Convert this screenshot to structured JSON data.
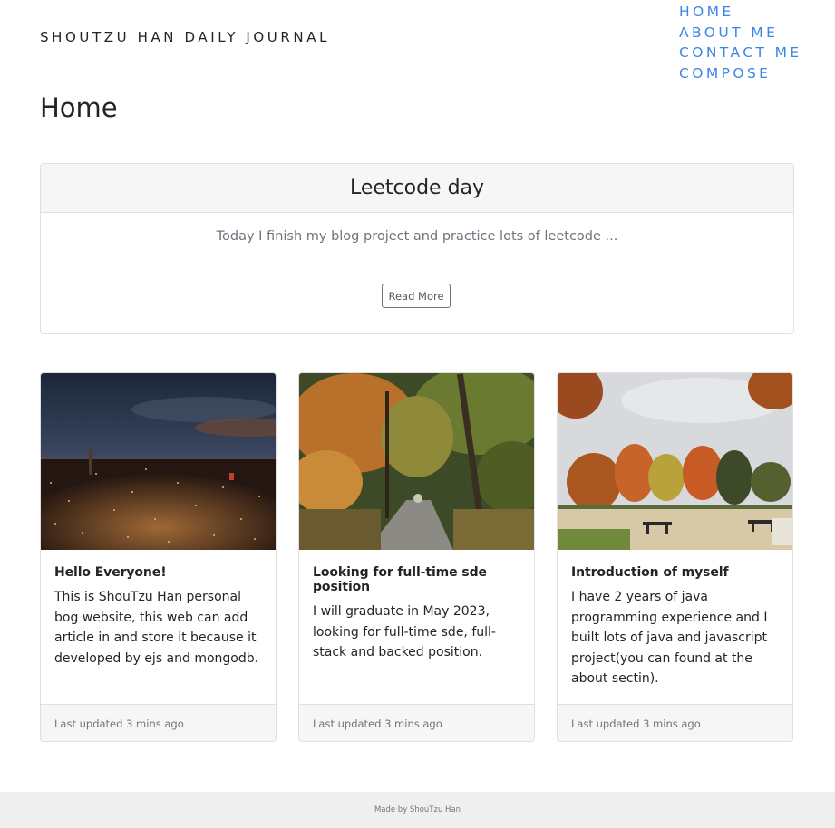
{
  "header": {
    "brand": "SHOUTZU HAN DAILY JOURNAL",
    "nav": [
      "HOME",
      "ABOUT ME",
      "CONTACT ME",
      "COMPOSE"
    ]
  },
  "page_title": "Home",
  "featured": {
    "title": "Leetcode day",
    "excerpt": "Today I finish my blog project and practice lots of leetcode ...",
    "button": "Read More"
  },
  "cards": [
    {
      "title": "Hello Everyone!",
      "text": "This is ShouTzu Han personal bog website, this web can add article in and store it because it developed by ejs and mongodb.",
      "footer": "Last updated 3 mins ago",
      "image": "night city skyline photo"
    },
    {
      "title": "Looking for full-time sde position",
      "text": "I will graduate in May 2023, looking for full-time sde, full-stack and backed position.",
      "footer": "Last updated 3 mins ago",
      "image": "autumn forest road photo"
    },
    {
      "title": "Introduction of myself",
      "text": "I have 2 years of java programming experience and I built lots of java and javascript project(you can found at the about sectin).",
      "footer": "Last updated 3 mins ago",
      "image": "autumn park with picnic tables photo"
    }
  ],
  "footer": "Made by ShouTzu Han",
  "colors": {
    "nav_link": "#3a85e8",
    "card_border": "#dfdfdf",
    "muted": "#6c757d"
  }
}
